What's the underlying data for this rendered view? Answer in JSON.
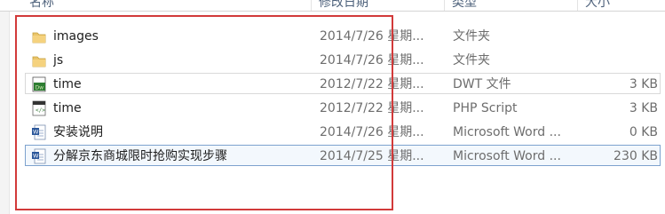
{
  "columns": {
    "name": "名称",
    "date": "修改日期",
    "type": "类型",
    "size": "大小"
  },
  "files": [
    {
      "icon": "folder-icon",
      "name": "images",
      "date": "2014/7/26 星期...",
      "type": "文件夹",
      "size": ""
    },
    {
      "icon": "folder-icon",
      "name": "js",
      "date": "2014/7/26 星期...",
      "type": "文件夹",
      "size": ""
    },
    {
      "icon": "dreamweaver-template-icon",
      "name": "time",
      "date": "2012/7/22 星期...",
      "type": "DWT 文件",
      "size": "3 KB"
    },
    {
      "icon": "php-file-icon",
      "name": "time",
      "date": "2012/7/22 星期...",
      "type": "PHP Script",
      "size": "3 KB"
    },
    {
      "icon": "word-document-icon",
      "name": "安装说明",
      "date": "2014/7/26 星期...",
      "type": "Microsoft Word ...",
      "size": "0 KB"
    },
    {
      "icon": "word-document-icon",
      "name": "分解京东商城限时抢购实现步骤",
      "date": "2014/7/25 星期...",
      "type": "Microsoft Word ...",
      "size": "230 KB"
    }
  ],
  "colors": {
    "annotation": "#d23a3a",
    "selection_border": "#7da2ce"
  }
}
